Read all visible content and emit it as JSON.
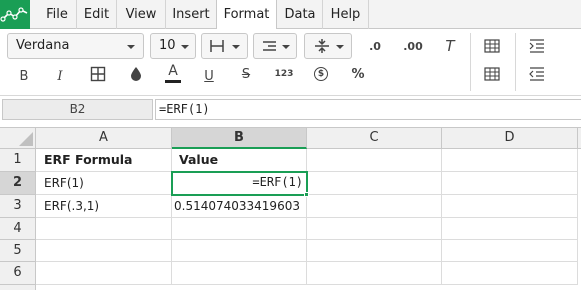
{
  "menu": {
    "items": [
      "File",
      "Edit",
      "View",
      "Insert",
      "Format",
      "Data",
      "Help"
    ],
    "active": "Format"
  },
  "toolbar": {
    "font_family": "Verdana",
    "font_size": "10",
    "number_format_label": "123",
    "currency_icon": "$",
    "percent_label": "%",
    "bold_label": "B",
    "italic_label": "I",
    "text_color_label": "A",
    "underline_label": "U",
    "strike_label": "S",
    "clear_format_label": "T",
    "decimal_decrease_label": ".0",
    "decimal_increase_label": ".00",
    "accent_color": "#1a9e55"
  },
  "formula_bar": {
    "cell_ref": "B2",
    "formula": "=ERF(1)"
  },
  "sheet": {
    "columns": [
      "A",
      "B",
      "C",
      "D"
    ],
    "selected_column": "B",
    "rows": [
      "1",
      "2",
      "3",
      "4",
      "5",
      "6"
    ],
    "selected_row": "2",
    "cells": {
      "A1": "ERF Formula",
      "B1": "Value",
      "A2": "ERF(1)",
      "B2": "=ERF(1)",
      "A3": "ERF(.3,1)",
      "B3": "0.514074033419603"
    }
  }
}
